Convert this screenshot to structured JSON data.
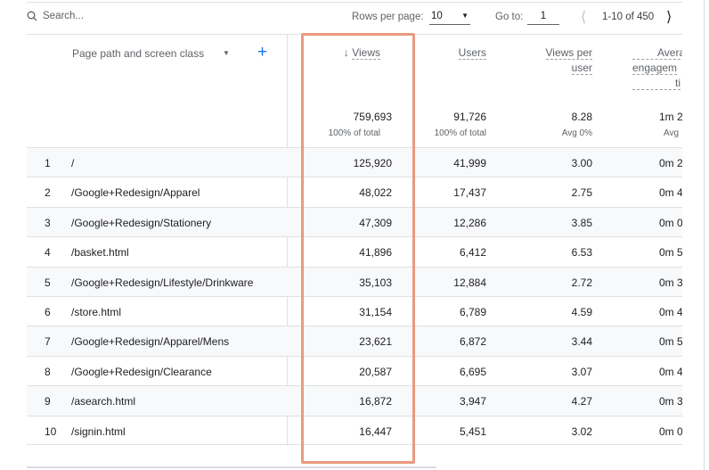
{
  "toolbar": {
    "search_placeholder": "Search...",
    "rows_per_page_label": "Rows per page:",
    "rows_per_page_value": "10",
    "goto_label": "Go to:",
    "goto_value": "1",
    "range": "1-10 of 450"
  },
  "table": {
    "dimension_header": "Page path and screen class",
    "columns": [
      {
        "label": "Views",
        "sorted": "descending"
      },
      {
        "label": "Users"
      },
      {
        "label": "Views per",
        "label2": "user"
      },
      {
        "label": "Avera",
        "label2": "engagem",
        "label3": "ti"
      }
    ],
    "totals": [
      {
        "value": "759,693",
        "sub": "100% of total"
      },
      {
        "value": "91,726",
        "sub": "100% of total"
      },
      {
        "value": "8.28",
        "sub": "Avg 0%"
      },
      {
        "value": "1m 2",
        "sub": "Avg"
      }
    ],
    "rows": [
      {
        "n": "1",
        "path": "/",
        "views": "125,920",
        "users": "41,999",
        "vpu": "3.00",
        "eng": "0m 2"
      },
      {
        "n": "2",
        "path": "/Google+Redesign/Apparel",
        "views": "48,022",
        "users": "17,437",
        "vpu": "2.75",
        "eng": "0m 4"
      },
      {
        "n": "3",
        "path": "/Google+Redesign/Stationery",
        "views": "47,309",
        "users": "12,286",
        "vpu": "3.85",
        "eng": "0m 0"
      },
      {
        "n": "4",
        "path": "/basket.html",
        "views": "41,896",
        "users": "6,412",
        "vpu": "6.53",
        "eng": "0m 5"
      },
      {
        "n": "5",
        "path": "/Google+Redesign/Lifestyle/Drinkware",
        "views": "35,103",
        "users": "12,884",
        "vpu": "2.72",
        "eng": "0m 3"
      },
      {
        "n": "6",
        "path": "/store.html",
        "views": "31,154",
        "users": "6,789",
        "vpu": "4.59",
        "eng": "0m 4"
      },
      {
        "n": "7",
        "path": "/Google+Redesign/Apparel/Mens",
        "views": "23,621",
        "users": "6,872",
        "vpu": "3.44",
        "eng": "0m 5"
      },
      {
        "n": "8",
        "path": "/Google+Redesign/Clearance",
        "views": "20,587",
        "users": "6,695",
        "vpu": "3.07",
        "eng": "0m 4"
      },
      {
        "n": "9",
        "path": "/asearch.html",
        "views": "16,872",
        "users": "3,947",
        "vpu": "4.27",
        "eng": "0m 3"
      },
      {
        "n": "10",
        "path": "/signin.html",
        "views": "16,447",
        "users": "5,451",
        "vpu": "3.02",
        "eng": "0m 0"
      }
    ]
  },
  "highlight_color": "#ea9a80",
  "accent": "#1a73e8"
}
